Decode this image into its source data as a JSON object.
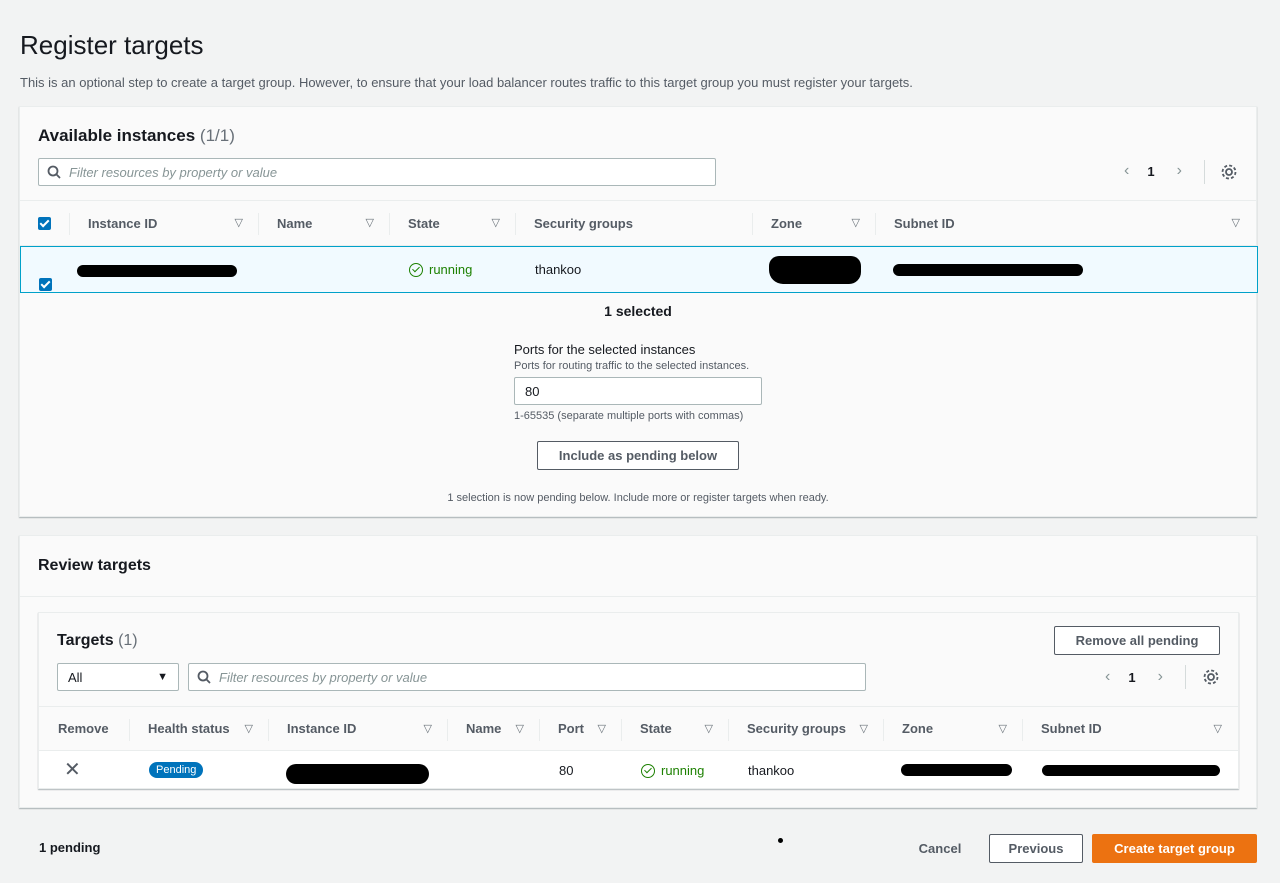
{
  "page": {
    "title": "Register targets",
    "description": "This is an optional step to create a target group. However, to ensure that your load balancer routes traffic to this target group you must register your targets."
  },
  "available": {
    "heading": "Available instances",
    "count": "(1/1)",
    "search_placeholder": "Filter resources by property or value",
    "page": "1",
    "columns": [
      "Instance ID",
      "Name",
      "State",
      "Security groups",
      "Zone",
      "Subnet ID"
    ],
    "row": {
      "instance_id": "[redacted]",
      "name": "",
      "state": "running",
      "security_groups": "thankoo",
      "zone": "[redacted]",
      "subnet_id": "[redacted]"
    },
    "selected_text": "1 selected",
    "ports_label": "Ports for the selected instances",
    "ports_desc": "Ports for routing traffic to the selected instances.",
    "ports_value": "80",
    "ports_hint": "1-65535 (separate multiple ports with commas)",
    "include_button": "Include as pending below",
    "pending_note": "1 selection is now pending below. Include more or register targets when ready."
  },
  "review": {
    "heading": "Review targets",
    "targets_heading": "Targets",
    "targets_count": "(1)",
    "remove_all_button": "Remove all pending",
    "filter_select": "All",
    "search_placeholder": "Filter resources by property or value",
    "page": "1",
    "columns": [
      "Remove",
      "Health status",
      "Instance ID",
      "Name",
      "Port",
      "State",
      "Security groups",
      "Zone",
      "Subnet ID"
    ],
    "row": {
      "health": "Pending",
      "instance_id": "[redacted]",
      "name": "",
      "port": "80",
      "state": "running",
      "security_groups": "thankoo",
      "zone": "[redacted]",
      "subnet_id": "[redacted]"
    }
  },
  "footer": {
    "pending_count": "1 pending",
    "cancel": "Cancel",
    "previous": "Previous",
    "create": "Create target group"
  },
  "colors": {
    "primary": "#ec7211",
    "link": "#0073bb",
    "success": "#1d8102"
  }
}
